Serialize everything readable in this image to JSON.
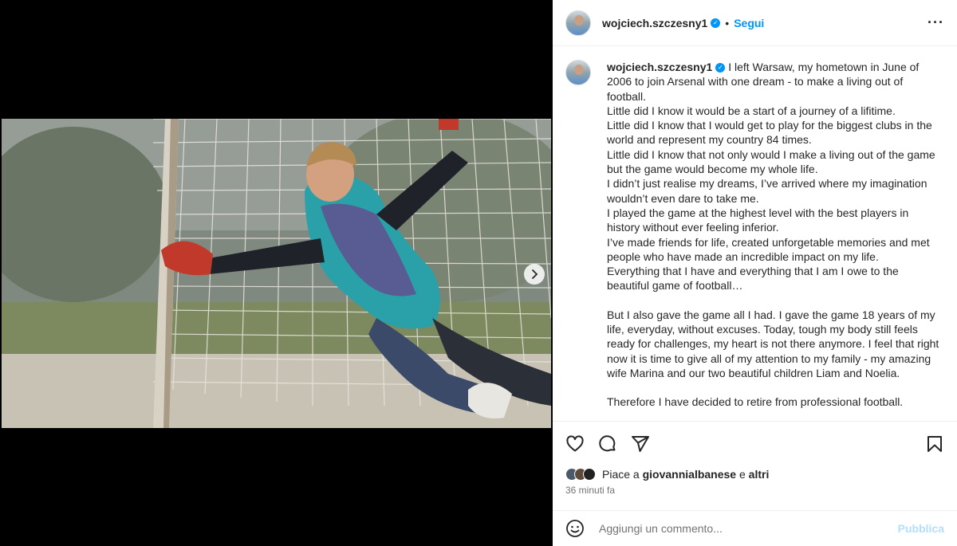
{
  "post": {
    "username": "wojciech.szczesny1",
    "separator": "•",
    "follow_label": "Segui",
    "more_label": "···"
  },
  "caption": {
    "username": "wojciech.szczesny1",
    "paragraphs": [
      "I left Warsaw, my hometown in June of 2006 to join Arsenal with one dream - to make a living out of football.",
      "Little did I know it would be a start of a journey of a lifitime.",
      "Little did I know that I would get to play for the biggest clubs in the world and represent my country 84 times.",
      "Little did I know that not only would I make a living out of the game but the game would become my whole life.",
      "I didn’t just realise my dreams, I’ve arrived where my imagination wouldn’t even dare to take me.",
      "I played the game at the highest level with the best players in history without ever feeling inferior.",
      "I’ve made friends for life, created unforgetable memories and met people who have made an incredible impact on my life.",
      "Everything that I have and everything that I am I owe to the beautiful game of football…",
      "",
      "But I also gave the game all I had. I gave the game 18 years of my life, everyday, without excuses. Today, tough my body still feels ready for challenges, my heart is not there anymore. I feel that right now it is time to give all of my attention to my family - my amazing wife Marina and our two beautiful children Liam and Noelia.",
      "",
      "Therefore I have decided to retire from professional football."
    ]
  },
  "likes": {
    "prefix": "Piace a",
    "user": "giovannialbanese",
    "conj": "e",
    "others": "altri"
  },
  "time_ago": "36 minuti fa",
  "comment": {
    "placeholder": "Aggiungi un commento...",
    "publish_label": "Pubblica"
  },
  "colors": {
    "accent": "#0095f6",
    "publish_disabled": "#b2dffc",
    "muted": "#737373"
  },
  "icons": [
    "heart-icon",
    "comment-icon",
    "share-icon",
    "bookmark-icon",
    "emoji-icon",
    "verified-icon",
    "chevron-right-icon"
  ]
}
